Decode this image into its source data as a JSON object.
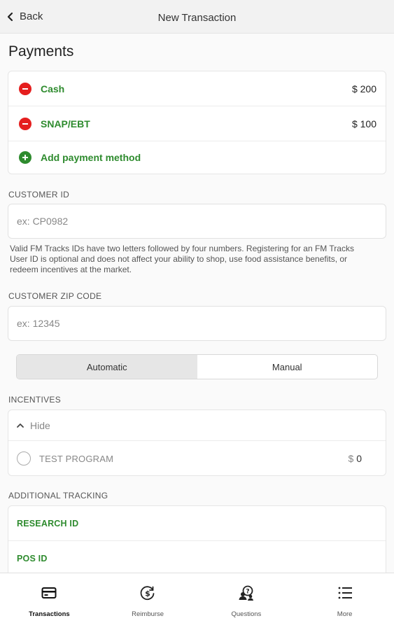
{
  "header": {
    "back_label": "Back",
    "title": "New Transaction"
  },
  "payments": {
    "heading": "Payments",
    "methods": [
      {
        "label": "Cash",
        "amount": "$ 200"
      },
      {
        "label": "SNAP/EBT",
        "amount": "$ 100"
      }
    ],
    "add_label": "Add payment method"
  },
  "customer_id": {
    "label": "CUSTOMER ID",
    "placeholder": "ex: CP0982",
    "help": "Valid FM Tracks IDs have two letters followed by four numbers. Registering for an FM Tracks User ID is optional and does not affect your ability to shop, use food assistance benefits, or redeem incentives at the market."
  },
  "zip": {
    "label": "CUSTOMER ZIP CODE",
    "placeholder": "ex: 12345"
  },
  "mode": {
    "options": [
      "Automatic",
      "Manual"
    ],
    "selected": "Automatic"
  },
  "incentives": {
    "label": "INCENTIVES",
    "toggle_label": "Hide",
    "program": {
      "label": "TEST PROGRAM",
      "currency": "$",
      "value": "0"
    }
  },
  "tracking": {
    "label": "ADDITIONAL TRACKING",
    "items": [
      "RESEARCH ID",
      "POS ID"
    ]
  },
  "tabs": [
    {
      "label": "Transactions",
      "icon": "card-icon",
      "active": true
    },
    {
      "label": "Reimburse",
      "icon": "dollar-cycle-icon",
      "active": false
    },
    {
      "label": "Questions",
      "icon": "question-people-icon",
      "active": false
    },
    {
      "label": "More",
      "icon": "list-icon",
      "active": false
    }
  ],
  "colors": {
    "accent_green": "#2e8b2e",
    "remove_red": "#e51e1e"
  }
}
